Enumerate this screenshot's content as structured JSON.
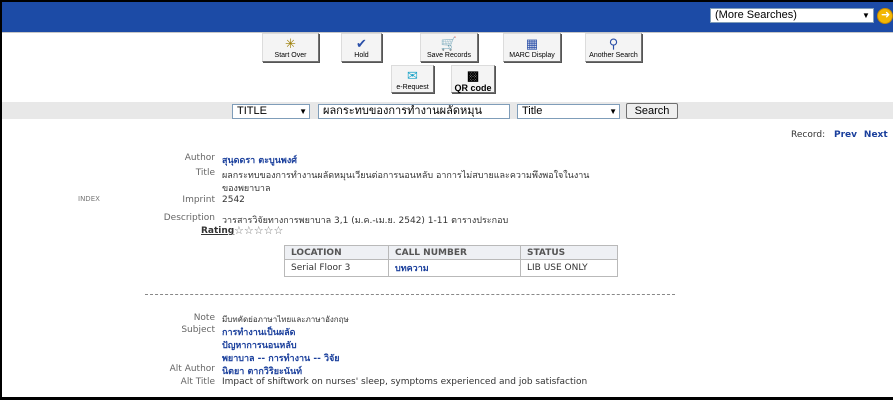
{
  "header": {
    "more_searches": "(More Searches)"
  },
  "toolbar": {
    "start_over": "Start Over",
    "hold": "Hold",
    "save_records": "Save Records",
    "marc_display": "MARC Display",
    "another_search": "Another Search",
    "e_request": "e-Request",
    "qr_code": "QR code"
  },
  "search": {
    "field": "TITLE",
    "query": "ผลกระทบของการทำงานผลัดหมุน",
    "sort": "Title",
    "button": "Search"
  },
  "record_nav": {
    "label": "Record:",
    "prev": "Prev",
    "next": "Next"
  },
  "record": {
    "author_label": "Author",
    "author": "สุนุดดรา ตะบูนพงศ์",
    "title_label": "Title",
    "title_line1": "ผลกระทบของการทำงานผลัดหมุนเวียนต่อการนอนหลับ อาการไม่สบายและความพึงพอใจในงาน",
    "title_line2": "ของพยาบาล",
    "index": "INDEX",
    "imprint_label": "Imprint",
    "imprint": "2542",
    "description_label": "Description",
    "description": "วารสารวิจัยทางการพยาบาล 3,1 (ม.ค.-เม.ย. 2542) 1-11 ตารางประกอบ",
    "rating_label": "Rating",
    "rating_stars": "☆☆☆☆☆",
    "note_label": "Note",
    "note": "มีบทคัดย่อภาษาไทยและภาษาอังกฤษ",
    "subject_label": "Subject",
    "subjects": [
      "การทำงานเป็นผลัด",
      "ปัญหาการนอนหลับ",
      "พยาบาล -- การทำงาน -- วิจัย"
    ],
    "alt_author_label": "Alt Author",
    "alt_author": "นิตยา ตากวิริยะนันท์",
    "alt_title_label": "Alt Title",
    "alt_title": "Impact of shiftwork on nurses' sleep, symptoms experienced and job satisfaction"
  },
  "holdings": {
    "headers": [
      "LOCATION",
      "CALL NUMBER",
      "STATUS"
    ],
    "rows": [
      [
        "Serial Floor 3",
        "บทความ",
        "LIB USE ONLY"
      ]
    ]
  },
  "colors": {
    "topbar": "#1c4ba6",
    "link": "#1a3f9c"
  }
}
